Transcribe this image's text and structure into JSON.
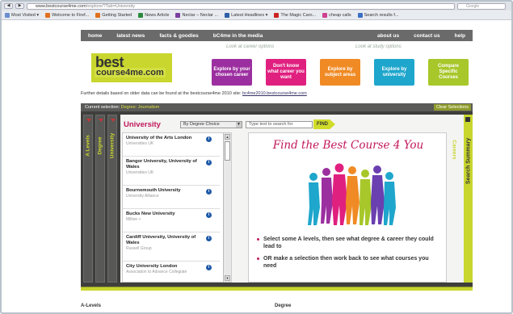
{
  "browser": {
    "url": "www.bestcourse4me.com/explore/?Tab=University",
    "url_domain": "www.bestcourse4me.com",
    "url_path": "/explore/?Tab=University",
    "search_placeholder": "Google",
    "bookmarks": [
      {
        "label": "Most Visited ▾",
        "color": "#6b8fcf"
      },
      {
        "label": "Welcome to Firef...",
        "color": "#e07020"
      },
      {
        "label": "Getting Started",
        "color": "#e07020"
      },
      {
        "label": "News Article",
        "color": "#2b8a3e"
      },
      {
        "label": "Nectar – Nectar ...",
        "color": "#7b3fa0"
      },
      {
        "label": "Latest Headlines ▾",
        "color": "#2e5fa8"
      },
      {
        "label": "The Magic Caro...",
        "color": "#cc2222"
      },
      {
        "label": "cheap calls",
        "color": "#d04090"
      },
      {
        "label": "Search results f...",
        "color": "#3b6fc4"
      }
    ]
  },
  "nav": {
    "items": [
      "home",
      "latest news",
      "facts & goodies",
      "bC4me in the media"
    ],
    "right_items": [
      "about us",
      "contact us",
      "help"
    ]
  },
  "logo": {
    "line1": "best",
    "line2": "course4me.com"
  },
  "hints": {
    "career": "Look at career options",
    "study": "Look at study options"
  },
  "buttons": [
    {
      "label": "Explore by your chosen career",
      "color": "#9c2fa0"
    },
    {
      "label": "Don't know what career you want",
      "color": "#e0207f"
    },
    {
      "label": "Explore by subject areas",
      "color": "#f08a24"
    },
    {
      "label": "Explore by university",
      "color": "#1fa6cc"
    },
    {
      "label": "Compare Specific Courses",
      "color": "#a7c72a"
    }
  ],
  "info": {
    "text": "Further details based on older data can be found at the bestcourse4me 2010 site:",
    "link": "bc4me2010.bestcourse4me.com"
  },
  "selection": {
    "prefix": "Current selection:",
    "value": "Degree: Journalism",
    "clear": "Clear Selections"
  },
  "tabs": {
    "alevels": "A Levels",
    "degree": "Degree",
    "university": "University",
    "careers": "Careers",
    "summary": "Search Summary"
  },
  "university_panel": {
    "title": "University",
    "select_value": "By Degree Choice",
    "search_placeholder": "Type text to search for",
    "find_label": "FIND",
    "universities": [
      {
        "name": "University of the Arts London",
        "group": "Universities UK"
      },
      {
        "name": "Bangor University, University of Wales",
        "group": "Universities UK"
      },
      {
        "name": "Bournemouth University",
        "group": "University Alliance"
      },
      {
        "name": "Bucks New University",
        "group": "Million +"
      },
      {
        "name": "Cardiff University, University of Wales",
        "group": "Russell Group"
      },
      {
        "name": "City University London",
        "group": "Association to Advance Collegiate"
      }
    ]
  },
  "promo": {
    "title": "Find the Best Course 4 You",
    "bullets": [
      "Select some A levels, then see what degree & career they could lead to",
      "OR make a selection then work back to see what courses you need"
    ]
  },
  "footer": {
    "left": "A-Levels",
    "right": "Degree"
  }
}
